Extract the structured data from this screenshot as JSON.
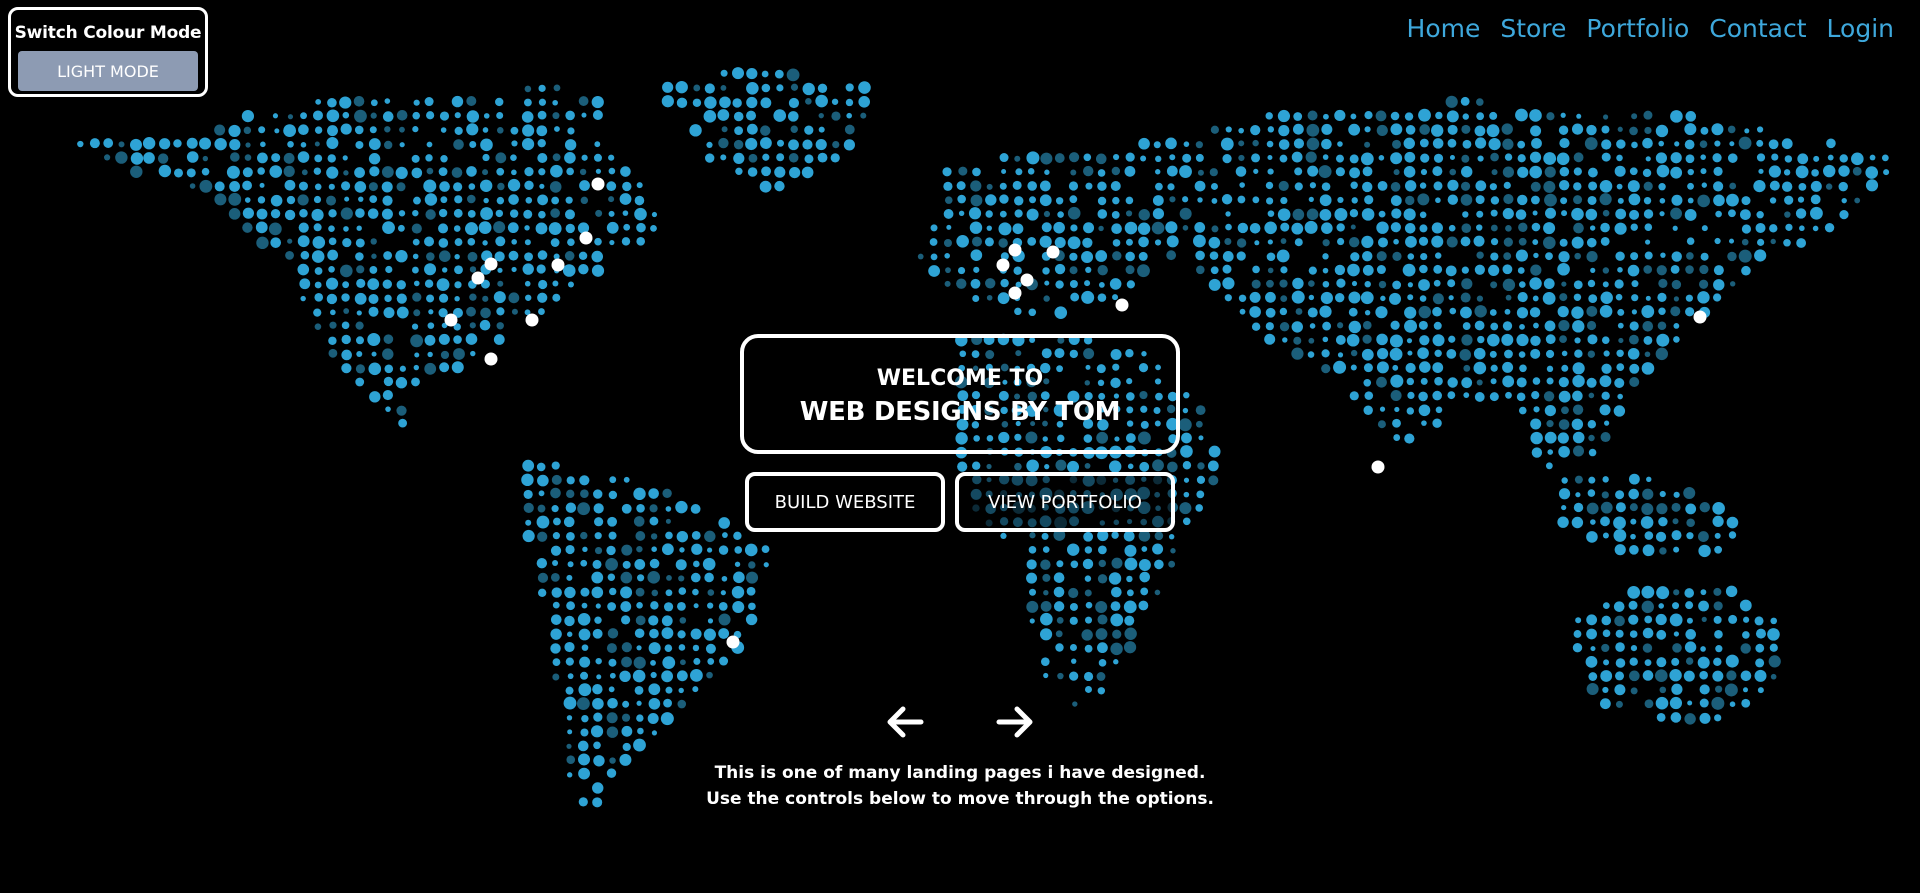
{
  "colors": {
    "background": "#000000",
    "dot_primary": "#2ea3d5",
    "dot_dim": "#1b5e7a",
    "highlight": "#ffffff",
    "nav_link": "#3ea8dc",
    "mode_button_bg": "#8d9bb3"
  },
  "colour_mode": {
    "title": "Switch Colour Mode",
    "button_label": "LIGHT MODE"
  },
  "nav": {
    "items": [
      {
        "label": "Home"
      },
      {
        "label": "Store"
      },
      {
        "label": "Portfolio"
      },
      {
        "label": "Contact"
      },
      {
        "label": "Login"
      }
    ]
  },
  "hero": {
    "welcome_line1": "WELCOME TO",
    "welcome_line2": "WEB DESIGNS BY TOM",
    "build_button": "BUILD WEBSITE",
    "portfolio_button": "VIEW PORTFOLIO"
  },
  "carousel": {
    "prev_icon": "arrow-left-icon",
    "next_icon": "arrow-right-icon",
    "caption_line1": "This is one of many landing pages i have designed.",
    "caption_line2": "Use the controls below to move through the options."
  },
  "background_graphic": {
    "icon": "dotted-world-map"
  }
}
